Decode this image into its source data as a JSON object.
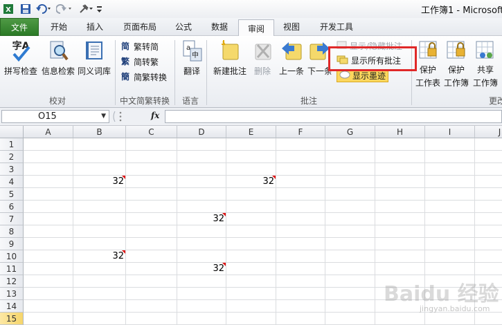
{
  "app": {
    "title": "工作簿1 - Microsoft"
  },
  "quick_access": {
    "icons": [
      "excel-icon",
      "save-icon",
      "undo-icon",
      "redo-icon",
      "customize-tool-icon"
    ]
  },
  "tabs": [
    {
      "label": "文件"
    },
    {
      "label": "开始"
    },
    {
      "label": "插入"
    },
    {
      "label": "页面布局"
    },
    {
      "label": "公式"
    },
    {
      "label": "数据"
    },
    {
      "label": "审阅"
    },
    {
      "label": "视图"
    },
    {
      "label": "开发工具"
    }
  ],
  "ribbon": {
    "proofing": {
      "spell": "拼写检查",
      "research": "信息检索",
      "thesaurus": "同义词库",
      "group": "校对"
    },
    "chinese": {
      "to_simplified": "繁转简",
      "to_traditional": "简转繁",
      "convert": "简繁转换",
      "group": "中文简繁转换"
    },
    "language": {
      "translate": "翻译",
      "group": "语言"
    },
    "comments": {
      "new": "新建批注",
      "delete": "删除",
      "prev": "上一条",
      "next": "下一条",
      "show_hide": "显示/隐藏批注",
      "show_all": "显示所有批注",
      "show_ink": "显示墨迹",
      "group": "批注"
    },
    "changes": {
      "protect_sheet": [
        "保护",
        "工作表"
      ],
      "protect_book": [
        "保护",
        "工作簿"
      ],
      "share": [
        "共享",
        "工作簿"
      ],
      "group": "更改"
    }
  },
  "formula_bar": {
    "name_box": "O15",
    "fx": "fx",
    "value": ""
  },
  "columns": [
    "A",
    "B",
    "C",
    "D",
    "E",
    "F",
    "G",
    "H",
    "I",
    "J"
  ],
  "rows": [
    "1",
    "2",
    "3",
    "4",
    "5",
    "6",
    "7",
    "8",
    "9",
    "10",
    "11",
    "12",
    "13",
    "14",
    "15"
  ],
  "cells": [
    {
      "ref": "B4",
      "value": "32",
      "comment": true
    },
    {
      "ref": "E4",
      "value": "32",
      "comment": true
    },
    {
      "ref": "D7",
      "value": "32",
      "comment": true
    },
    {
      "ref": "B10",
      "value": "32",
      "comment": true
    },
    {
      "ref": "D11",
      "value": "32",
      "comment": true
    }
  ],
  "highlight": {
    "color": "#e02828"
  },
  "watermark": {
    "text": "Baidu 经验",
    "url": "jingyan.baidu.com"
  }
}
